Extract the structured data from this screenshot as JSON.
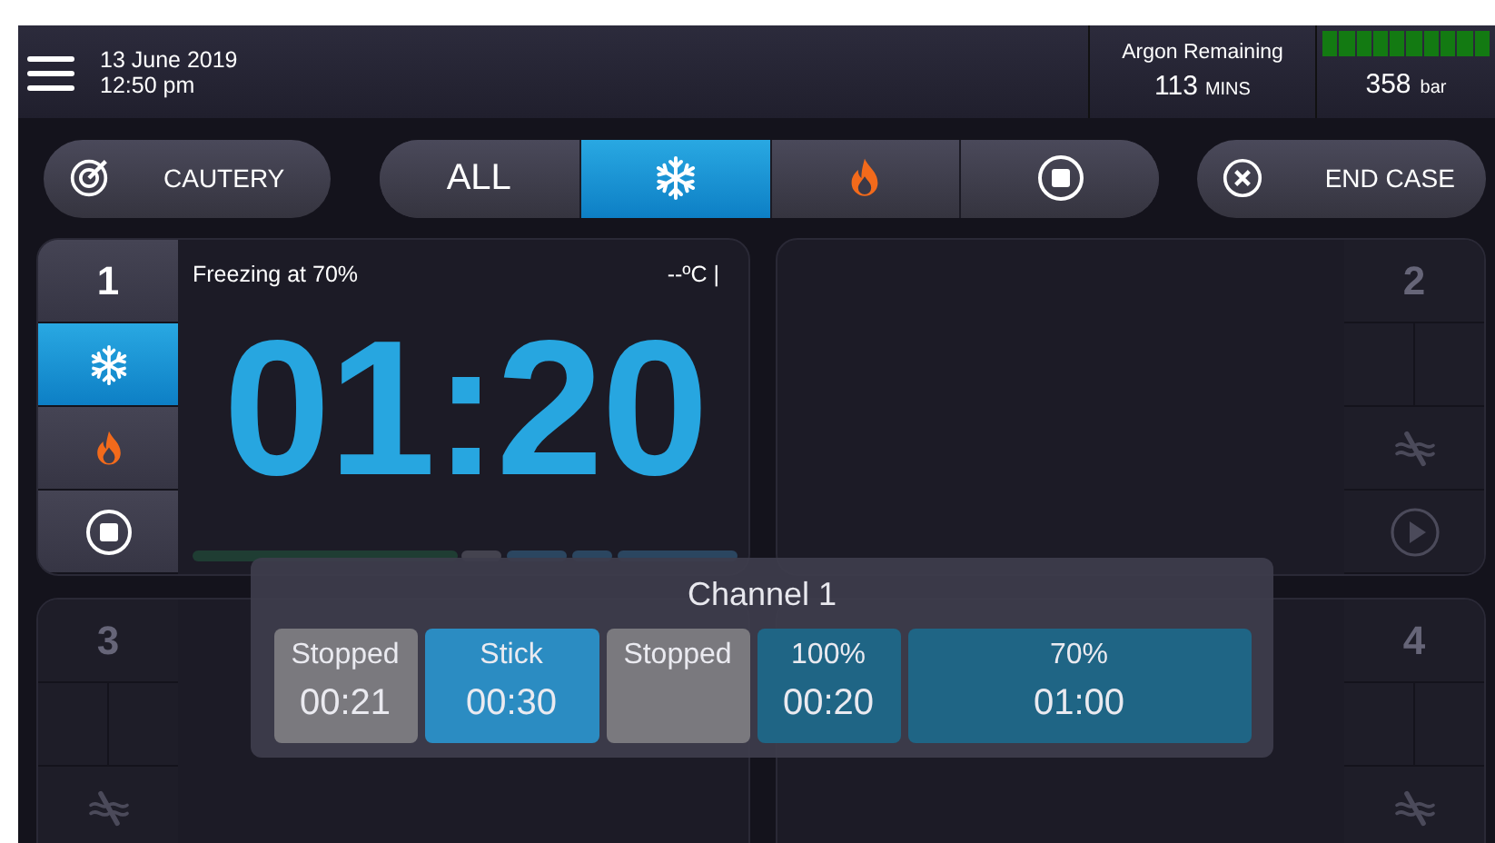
{
  "header": {
    "date": "13 June 2019",
    "time": "12:50 pm",
    "argon": {
      "label": "Argon Remaining",
      "value": "113",
      "unit": "MINS"
    },
    "pressure": {
      "level": 1,
      "value": "358",
      "unit": "bar"
    }
  },
  "toolbar": {
    "cautery": {
      "label": "CAUTERY"
    },
    "modes": [
      {
        "kind": "all",
        "label": "ALL",
        "selected": false
      },
      {
        "kind": "freeze",
        "selected": true
      },
      {
        "kind": "thaw",
        "selected": false
      },
      {
        "kind": "stop",
        "selected": false
      }
    ],
    "end_case": {
      "label": "END CASE"
    }
  },
  "channels": [
    {
      "number": "1",
      "active": true,
      "buttons": [
        {
          "kind": "freeze",
          "selected": true
        },
        {
          "kind": "thaw",
          "selected": false
        },
        {
          "kind": "stop",
          "selected": false
        }
      ],
      "status": "Freezing at 70%",
      "temperature": "--ºC |",
      "timer": "01:20"
    },
    {
      "number": "2",
      "active": false
    },
    {
      "number": "3",
      "active": false
    },
    {
      "number": "4",
      "active": false
    }
  ],
  "popup": {
    "title": "Channel 1",
    "steps": [
      {
        "kind": "stopped",
        "label": "Stopped",
        "time": "00:21"
      },
      {
        "kind": "stick",
        "label": "Stick",
        "time": "00:30"
      },
      {
        "kind": "stopped",
        "label": "Stopped"
      },
      {
        "kind": "freeze",
        "label": "100%",
        "time": "00:20"
      },
      {
        "kind": "freeze",
        "label": "70%",
        "time": "01:00"
      }
    ]
  }
}
